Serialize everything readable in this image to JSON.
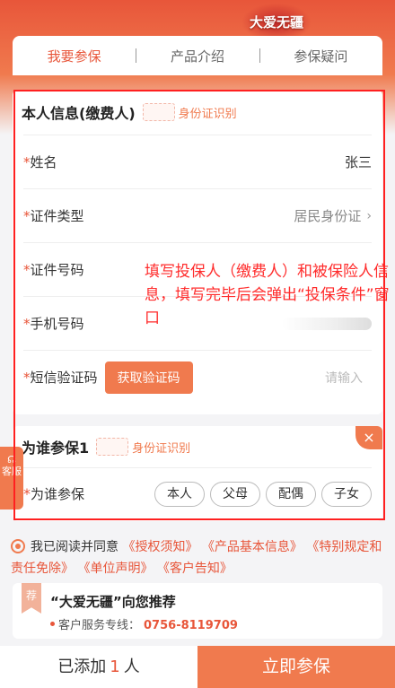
{
  "brand": {
    "logo_text": "大爱无疆"
  },
  "tabs": [
    {
      "label": "我要参保"
    },
    {
      "label": "产品介绍"
    },
    {
      "label": "参保疑问"
    }
  ],
  "insured_section": {
    "title": "本人信息(缴费人)",
    "id_recognition": "身份证识别",
    "fields": {
      "name": {
        "label": "姓名",
        "value": "张三"
      },
      "id_type": {
        "label": "证件类型",
        "value": "居民身份证"
      },
      "id_number": {
        "label": "证件号码"
      },
      "phone": {
        "label": "手机号码"
      },
      "sms_code": {
        "label": "短信验证码",
        "button": "获取验证码",
        "placeholder": "请输入"
      }
    }
  },
  "annotation_note": "填写投保人（缴费人）和被保险人信息，填写完毕后会弹出“投保条件”窗口",
  "beneficiary_section": {
    "title": "为谁参保1",
    "id_recognition": "身份证识别",
    "close_symbol": "×",
    "relation_label": "为谁参保",
    "options": [
      "本人",
      "父母",
      "配偶",
      "子女"
    ]
  },
  "side_tab": {
    "label": "客服"
  },
  "agreement": {
    "prefix": "我已阅读并同意",
    "links": [
      "《授权须知》",
      "《产品基本信息》",
      "《特别规定和责任免除》",
      "《单位声明》",
      "《客户告知》"
    ]
  },
  "recommend": {
    "badge": "荐",
    "title": "“大爱无疆”向您推荐",
    "service_label": "客户服务专线：",
    "service_phone": "0756-8119709"
  },
  "footer": {
    "added_prefix": "已添加",
    "added_count": "1",
    "added_suffix": "人",
    "submit_label": "立即参保"
  },
  "colors": {
    "accent": "#f07a4e",
    "highlight": "#ff2020"
  }
}
